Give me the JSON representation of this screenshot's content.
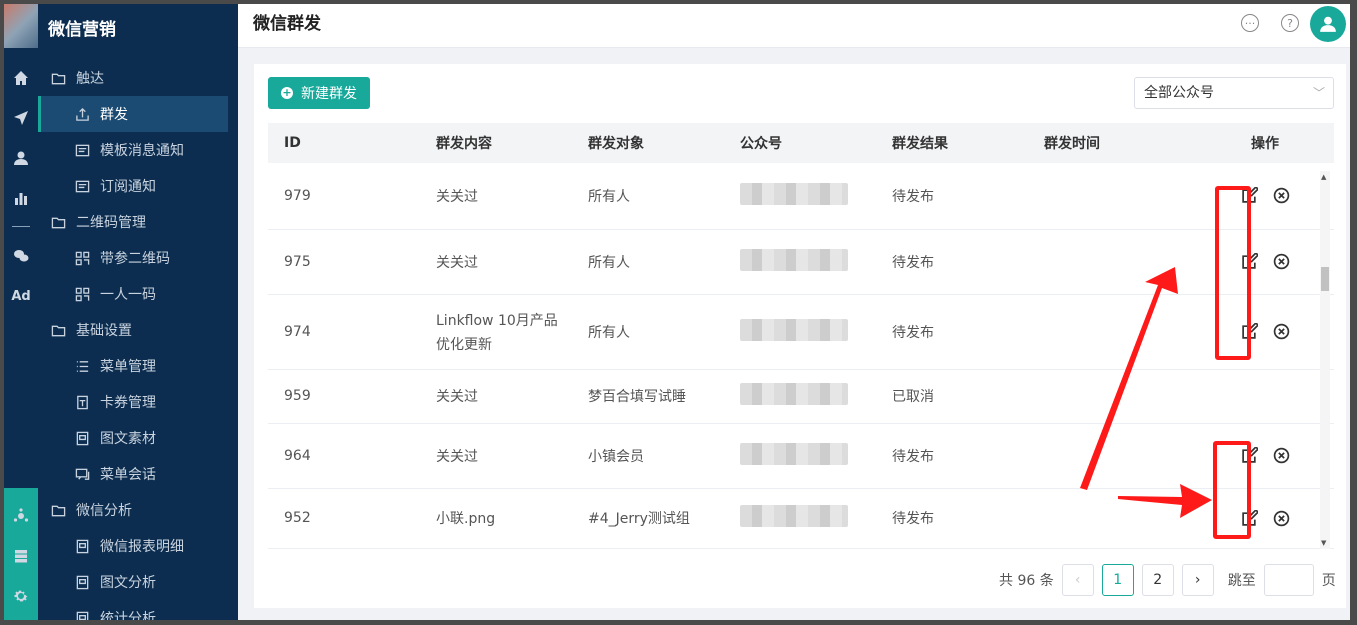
{
  "sidebar": {
    "app_title": "微信营销",
    "items": [
      {
        "label": "触达"
      },
      {
        "label": "群发"
      },
      {
        "label": "模板消息通知"
      },
      {
        "label": "订阅通知"
      },
      {
        "label": "二维码管理"
      },
      {
        "label": "带参二维码"
      },
      {
        "label": "一人一码"
      },
      {
        "label": "基础设置"
      },
      {
        "label": "菜单管理"
      },
      {
        "label": "卡券管理"
      },
      {
        "label": "图文素材"
      },
      {
        "label": "菜单会话"
      },
      {
        "label": "微信分析"
      },
      {
        "label": "微信报表明细"
      },
      {
        "label": "图文分析"
      },
      {
        "label": "统计分析"
      }
    ]
  },
  "rail": {
    "ad_label": "Ad"
  },
  "header": {
    "title": "微信群发"
  },
  "toolbar": {
    "new_button": "新建群发",
    "account_select": "全部公众号"
  },
  "table": {
    "columns": [
      "ID",
      "群发内容",
      "群发对象",
      "公众号",
      "群发结果",
      "群发时间",
      "操作"
    ],
    "rows": [
      {
        "id": "979",
        "content": "关关过",
        "target": "所有人",
        "result": "待发布",
        "time": ""
      },
      {
        "id": "975",
        "content": "关关过",
        "target": "所有人",
        "result": "待发布",
        "time": ""
      },
      {
        "id": "974",
        "content": "Linkflow 10月产品",
        "content2": "优化更新",
        "target": "所有人",
        "result": "待发布",
        "time": ""
      },
      {
        "id": "959",
        "content": "关关过",
        "target": "梦百合填写试睡",
        "result": "已取消",
        "time": ""
      },
      {
        "id": "964",
        "content": "关关过",
        "target": "小镇会员",
        "result": "待发布",
        "time": ""
      },
      {
        "id": "952",
        "content": "小联.png",
        "target": "#4_Jerry测试组",
        "result": "待发布",
        "time": ""
      }
    ]
  },
  "pagination": {
    "total": "共 96 条",
    "page1": "1",
    "page2": "2",
    "jump_label": "跳至",
    "page_unit": "页"
  },
  "colors": {
    "accent": "#18a99b",
    "sidebar": "#0c2d4f",
    "annotation": "#ff1a1a"
  }
}
